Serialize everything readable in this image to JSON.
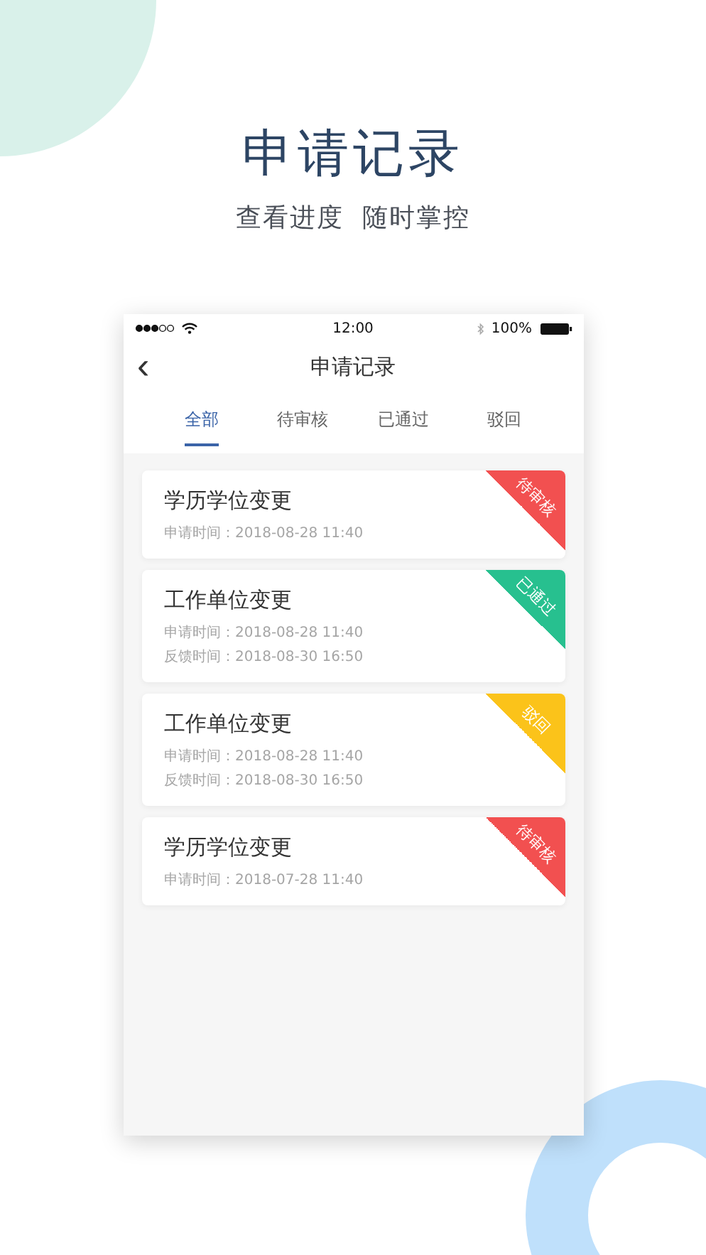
{
  "headline": "申请记录",
  "subtitle": "查看进度  随时掌控",
  "status_bar": {
    "time": "12:00",
    "battery": "100%"
  },
  "nav": {
    "back": "‹",
    "title": "申请记录"
  },
  "tabs": [
    {
      "label": "全部",
      "selected": true
    },
    {
      "label": "待审核",
      "selected": false
    },
    {
      "label": "已通过",
      "selected": false
    },
    {
      "label": "驳回",
      "selected": false
    }
  ],
  "records": [
    {
      "title": "学历学位变更",
      "lines": [
        "申请时间：2018-08-28 11:40"
      ],
      "status": "待审核",
      "color": "#f25050"
    },
    {
      "title": "工作单位变更",
      "lines": [
        "申请时间：2018-08-28 11:40",
        "反馈时间：2018-08-30 16:50"
      ],
      "status": "已通过",
      "color": "#27c08f"
    },
    {
      "title": "工作单位变更",
      "lines": [
        "申请时间：2018-08-28 11:40",
        "反馈时间：2018-08-30 16:50"
      ],
      "status": "驳回",
      "color": "#fbc31a"
    },
    {
      "title": "学历学位变更",
      "lines": [
        "申请时间：2018-07-28 11:40"
      ],
      "status": "待审核",
      "color": "#f25050"
    }
  ]
}
